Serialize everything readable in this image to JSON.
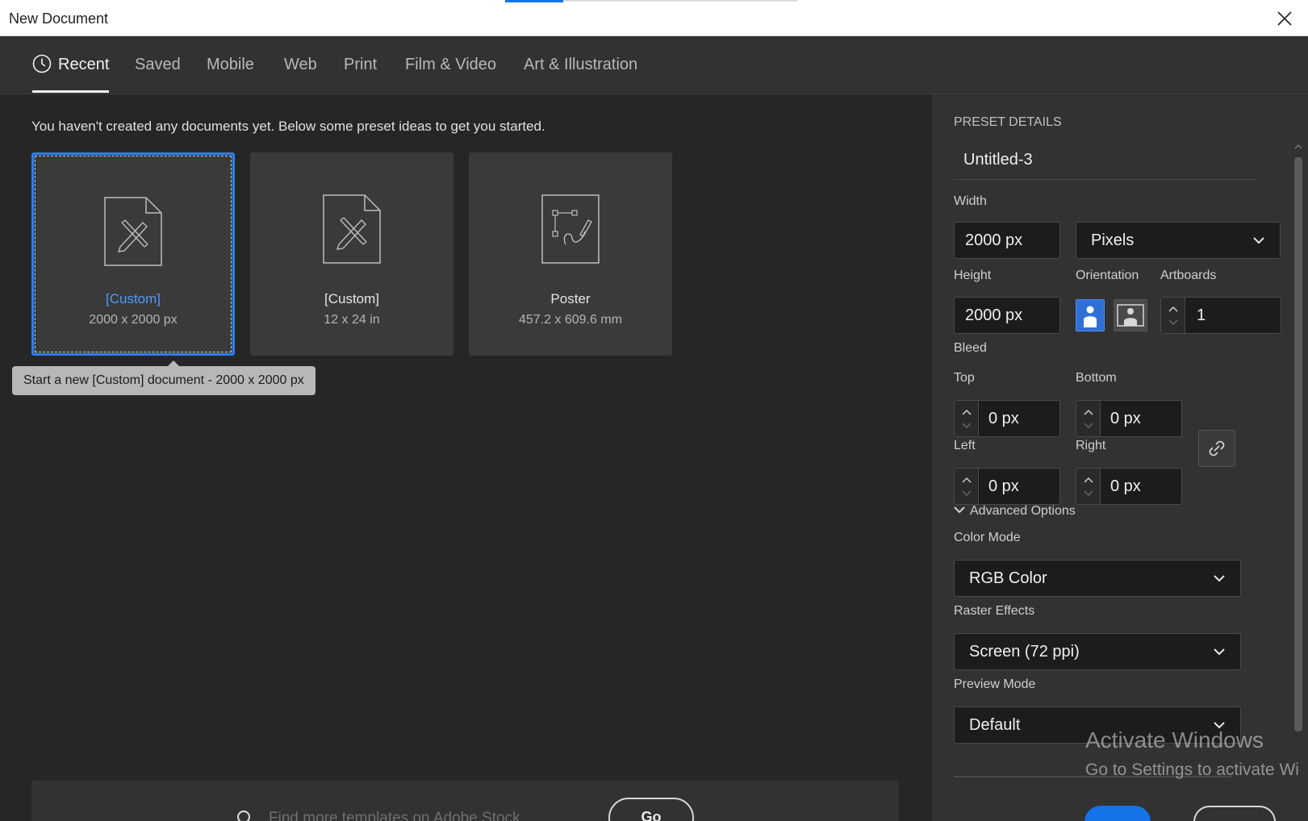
{
  "window": {
    "title": "New Document"
  },
  "tabs": [
    {
      "label": "Recent"
    },
    {
      "label": "Saved"
    },
    {
      "label": "Mobile"
    },
    {
      "label": "Web"
    },
    {
      "label": "Print"
    },
    {
      "label": "Film & Video"
    },
    {
      "label": "Art & Illustration"
    }
  ],
  "intro_text": "You haven't created any documents yet. Below some preset ideas to get you started.",
  "presets": [
    {
      "name": "[Custom]",
      "size": "2000 x 2000 px",
      "icon": "document-ruler-pencil-icon"
    },
    {
      "name": "[Custom]",
      "size": "12 x 24 in",
      "icon": "document-ruler-pencil-icon"
    },
    {
      "name": "Poster",
      "size": "457.2 x 609.6 mm",
      "icon": "document-path-pen-icon"
    }
  ],
  "tooltip": "Start a new [Custom] document - 2000 x 2000 px",
  "stock": {
    "placeholder": "Find more templates on Adobe Stock",
    "go_label": "Go"
  },
  "details": {
    "header": "PRESET DETAILS",
    "doc_name": "Untitled-3",
    "width_label": "Width",
    "width_value": "2000 px",
    "units": "Pixels",
    "height_label": "Height",
    "height_value": "2000 px",
    "orientation_label": "Orientation",
    "artboards_label": "Artboards",
    "artboards_value": "1",
    "bleed_label": "Bleed",
    "bleed": {
      "top_label": "Top",
      "top": "0 px",
      "bottom_label": "Bottom",
      "bottom": "0 px",
      "left_label": "Left",
      "left": "0 px",
      "right_label": "Right",
      "right": "0 px"
    },
    "advanced_label": "Advanced Options",
    "color_mode_label": "Color Mode",
    "color_mode": "RGB Color",
    "raster_label": "Raster Effects",
    "raster": "Screen (72 ppi)",
    "preview_label": "Preview Mode",
    "preview": "Default"
  },
  "watermark": {
    "line1": "Activate Windows",
    "line2": "Go to Settings to activate Wi"
  },
  "colors": {
    "accent": "#1473e6",
    "panel": "#323232",
    "background": "#262626"
  }
}
